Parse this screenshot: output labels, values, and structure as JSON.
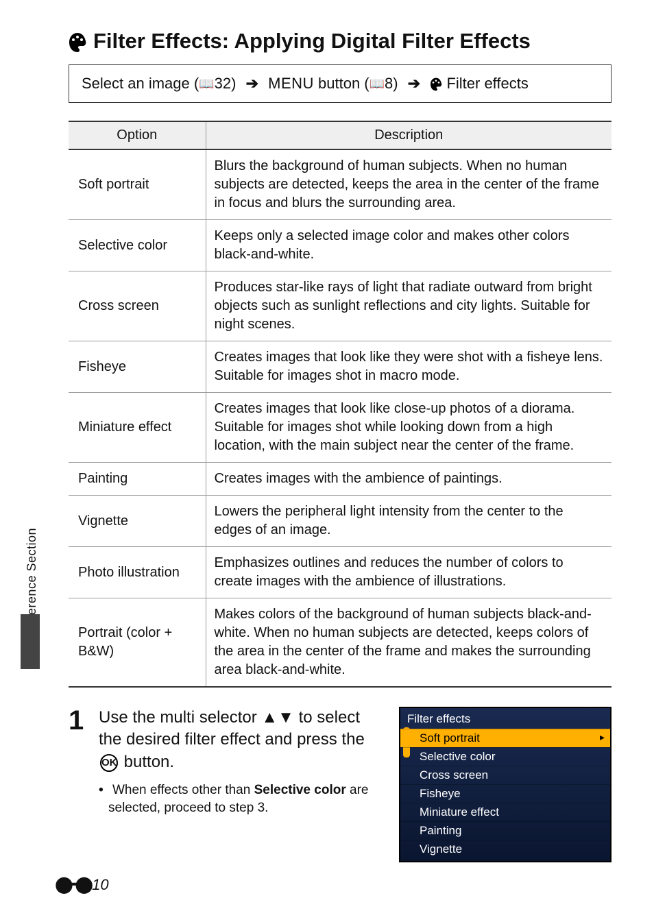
{
  "side_label": "Reference Section",
  "title": "Filter Effects: Applying Digital Filter Effects",
  "breadcrumb": {
    "part1": "Select an image (",
    "ref1": "32",
    "arrow": "➔",
    "menu_word": "MENU",
    "part2": " button (",
    "ref2": "8",
    "part3": " Filter effects"
  },
  "table": {
    "head_option": "Option",
    "head_desc": "Description",
    "rows": [
      {
        "name": "Soft portrait",
        "desc": "Blurs the background of human subjects. When no human subjects are detected, keeps the area in the center of the frame in focus and blurs the surrounding area."
      },
      {
        "name": "Selective color",
        "desc": "Keeps only a selected image color and makes other colors black-and-white."
      },
      {
        "name": "Cross screen",
        "desc": "Produces star-like rays of light that radiate outward from bright objects such as sunlight reflections and city lights. Suitable for night scenes."
      },
      {
        "name": "Fisheye",
        "desc": "Creates images that look like they were shot with a fisheye lens. Suitable for images shot in macro mode."
      },
      {
        "name": "Miniature effect",
        "desc": "Creates images that look like close-up photos of a diorama. Suitable for images shot while looking down from a high location, with the main subject near the center of the frame."
      },
      {
        "name": "Painting",
        "desc": "Creates images with the ambience of paintings."
      },
      {
        "name": "Vignette",
        "desc": "Lowers the peripheral light intensity from the center to the edges of an image."
      },
      {
        "name": "Photo illustration",
        "desc": "Emphasizes outlines and reduces the number of colors to create images with the ambience of illustrations."
      },
      {
        "name": "Portrait (color + B&W)",
        "desc": "Makes colors of the background of human subjects black-and-white. When no human subjects are detected, keeps colors of the area in the center of the frame and makes the surrounding area black-and-white."
      }
    ]
  },
  "step": {
    "num": "1",
    "lead_a": "Use the multi selector ",
    "lead_b": " to select the desired filter effect and press the ",
    "lead_c": " button.",
    "ok": "OK",
    "bullet_a": "When effects other than ",
    "bullet_bold": "Selective color",
    "bullet_b": " are selected, proceed to step 3."
  },
  "menu": {
    "title": "Filter effects",
    "items": [
      "Soft portrait",
      "Selective color",
      "Cross screen",
      "Fisheye",
      "Miniature effect",
      "Painting",
      "Vignette"
    ],
    "selected_index": 0
  },
  "footer_page": "10"
}
